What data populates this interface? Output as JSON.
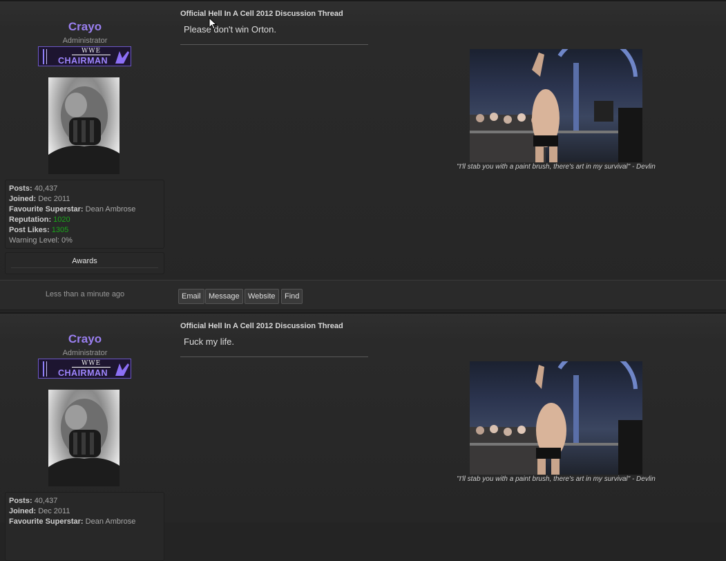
{
  "posts": [
    {
      "username": "Crayo",
      "user_title": "Administrator",
      "rank_banner": {
        "wwe": "WWE",
        "text": "CHAIRMAN"
      },
      "stats": {
        "posts_label": "Posts:",
        "posts_value": "40,437",
        "joined_label": "Joined:",
        "joined_value": "Dec 2011",
        "fav_label": "Favourite Superstar:",
        "fav_value": "Dean Ambrose",
        "rep_label": "Reputation:",
        "rep_value": "1020",
        "likes_label": "Post Likes:",
        "likes_value": "1305",
        "warn_label": "Warning Level:",
        "warn_value": "0%"
      },
      "awards_label": "Awards",
      "thread_title": "Official Hell In A Cell 2012 Discussion Thread",
      "message": "Please don't win Orton.",
      "signature_caption": "\"I'll stab you with a paint brush, there's art in my survival\" - Devlin",
      "time": "Less than a minute ago",
      "buttons": {
        "email": "Email",
        "message": "Message",
        "website": "Website",
        "find": "Find"
      }
    },
    {
      "username": "Crayo",
      "user_title": "Administrator",
      "rank_banner": {
        "wwe": "WWE",
        "text": "CHAIRMAN"
      },
      "stats": {
        "posts_label": "Posts:",
        "posts_value": "40,437",
        "joined_label": "Joined:",
        "joined_value": "Dec 2011",
        "fav_label": "Favourite Superstar:",
        "fav_value": "Dean Ambrose"
      },
      "thread_title": "Official Hell In A Cell 2012 Discussion Thread",
      "message": "Fuck my life.",
      "signature_caption": "\"I'll stab you with a paint brush, there's art in my survival\" - Devlin"
    }
  ],
  "colors": {
    "username": "#9a7ff0",
    "green_stat": "#1aa81a",
    "background": "#242424"
  }
}
